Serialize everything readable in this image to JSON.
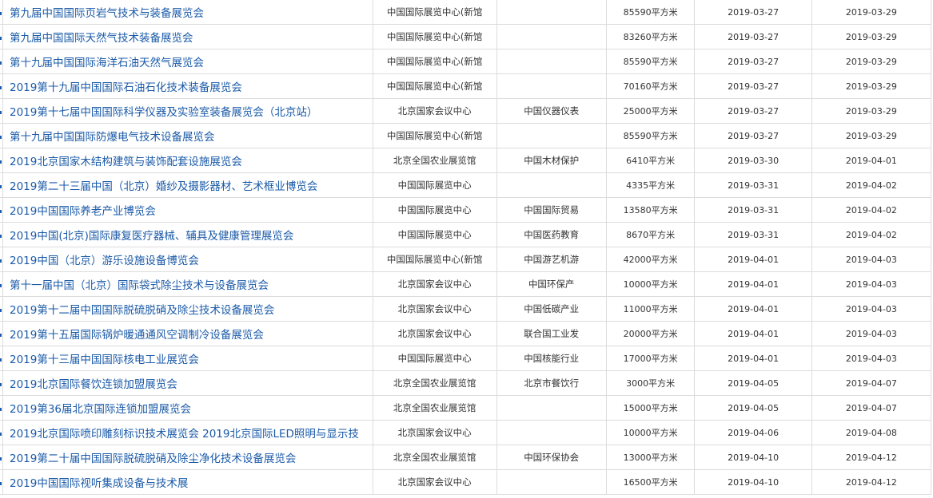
{
  "rows": [
    {
      "name": "第九届中国国际页岩气技术与装备展览会",
      "venue": "中国国际展览中心(新馆",
      "organizer": "",
      "area": "85590平方米",
      "start": "2019-03-27",
      "end": "2019-03-29"
    },
    {
      "name": "第九届中国国际天然气技术装备展览会",
      "venue": "中国国际展览中心(新馆",
      "organizer": "",
      "area": "83260平方米",
      "start": "2019-03-27",
      "end": "2019-03-29"
    },
    {
      "name": "第十九届中国国际海洋石油天然气展览会",
      "venue": "中国国际展览中心(新馆",
      "organizer": "",
      "area": "85590平方米",
      "start": "2019-03-27",
      "end": "2019-03-29"
    },
    {
      "name": "2019第十九届中国国际石油石化技术装备展览会",
      "venue": "中国国际展览中心(新馆",
      "organizer": "",
      "area": "70160平方米",
      "start": "2019-03-27",
      "end": "2019-03-29"
    },
    {
      "name": "2019第十七届中国国际科学仪器及实验室装备展览会（北京站）",
      "venue": "北京国家会议中心",
      "organizer": "中国仪器仪表",
      "area": "25000平方米",
      "start": "2019-03-27",
      "end": "2019-03-29"
    },
    {
      "name": "第十九届中国国际防爆电气技术设备展览会",
      "venue": "中国国际展览中心(新馆",
      "organizer": "",
      "area": "85590平方米",
      "start": "2019-03-27",
      "end": "2019-03-29"
    },
    {
      "name": "2019北京国家木结构建筑与装饰配套设施展览会",
      "venue": "北京全国农业展览馆",
      "organizer": "中国木材保护",
      "area": "6410平方米",
      "start": "2019-03-30",
      "end": "2019-04-01"
    },
    {
      "name": "2019第二十三届中国（北京）婚纱及摄影器材、艺术框业博览会",
      "venue": "中国国际展览中心",
      "organizer": "",
      "area": "4335平方米",
      "start": "2019-03-31",
      "end": "2019-04-02"
    },
    {
      "name": "2019中国国际养老产业博览会",
      "venue": "中国国际展览中心",
      "organizer": "中国国际贸易",
      "area": "13580平方米",
      "start": "2019-03-31",
      "end": "2019-04-02"
    },
    {
      "name": "2019中国(北京)国际康复医疗器械、辅具及健康管理展览会",
      "venue": "中国国际展览中心",
      "organizer": "中国医药教育",
      "area": "8670平方米",
      "start": "2019-03-31",
      "end": "2019-04-02"
    },
    {
      "name": "2019中国（北京）游乐设施设备博览会",
      "venue": "中国国际展览中心(新馆",
      "organizer": "中国游艺机游",
      "area": "42000平方米",
      "start": "2019-04-01",
      "end": "2019-04-03"
    },
    {
      "name": "第十一届中国（北京）国际袋式除尘技术与设备展览会",
      "venue": "北京国家会议中心",
      "organizer": "中国环保产",
      "area": "10000平方米",
      "start": "2019-04-01",
      "end": "2019-04-03"
    },
    {
      "name": "2019第十二届中国国际脱硫脱硝及除尘技术设备展览会",
      "venue": "北京国家会议中心",
      "organizer": "中国低碳产业",
      "area": "11000平方米",
      "start": "2019-04-01",
      "end": "2019-04-03"
    },
    {
      "name": "2019第十五届国际锅炉暖通通风空调制冷设备展览会",
      "venue": "北京国家会议中心",
      "organizer": "联合国工业发",
      "area": "20000平方米",
      "start": "2019-04-01",
      "end": "2019-04-03"
    },
    {
      "name": "2019第十三届中国国际核电工业展览会",
      "venue": "中国国际展览中心",
      "organizer": "中国核能行业",
      "area": "17000平方米",
      "start": "2019-04-01",
      "end": "2019-04-03"
    },
    {
      "name": "2019北京国际餐饮连锁加盟展览会",
      "venue": "北京全国农业展览馆",
      "organizer": "北京市餐饮行",
      "area": "3000平方米",
      "start": "2019-04-05",
      "end": "2019-04-07"
    },
    {
      "name": "2019第36届北京国际连锁加盟展览会",
      "venue": "北京全国农业展览馆",
      "organizer": "",
      "area": "15000平方米",
      "start": "2019-04-05",
      "end": "2019-04-07"
    },
    {
      "name": "2019北京国际喷印雕刻标识技术展览会 2019北京国际LED照明与显示技",
      "venue": "北京国家会议中心",
      "organizer": "",
      "area": "10000平方米",
      "start": "2019-04-06",
      "end": "2019-04-08"
    },
    {
      "name": "2019第二十届中国国际脱硫脱硝及除尘净化技术设备展览会",
      "venue": "北京全国农业展览馆",
      "organizer": "中国环保协会",
      "area": "13000平方米",
      "start": "2019-04-10",
      "end": "2019-04-12"
    },
    {
      "name": "2019中国国际视听集成设备与技术展",
      "venue": "北京国家会议中心",
      "organizer": "",
      "area": "16500平方米",
      "start": "2019-04-10",
      "end": "2019-04-12"
    }
  ]
}
